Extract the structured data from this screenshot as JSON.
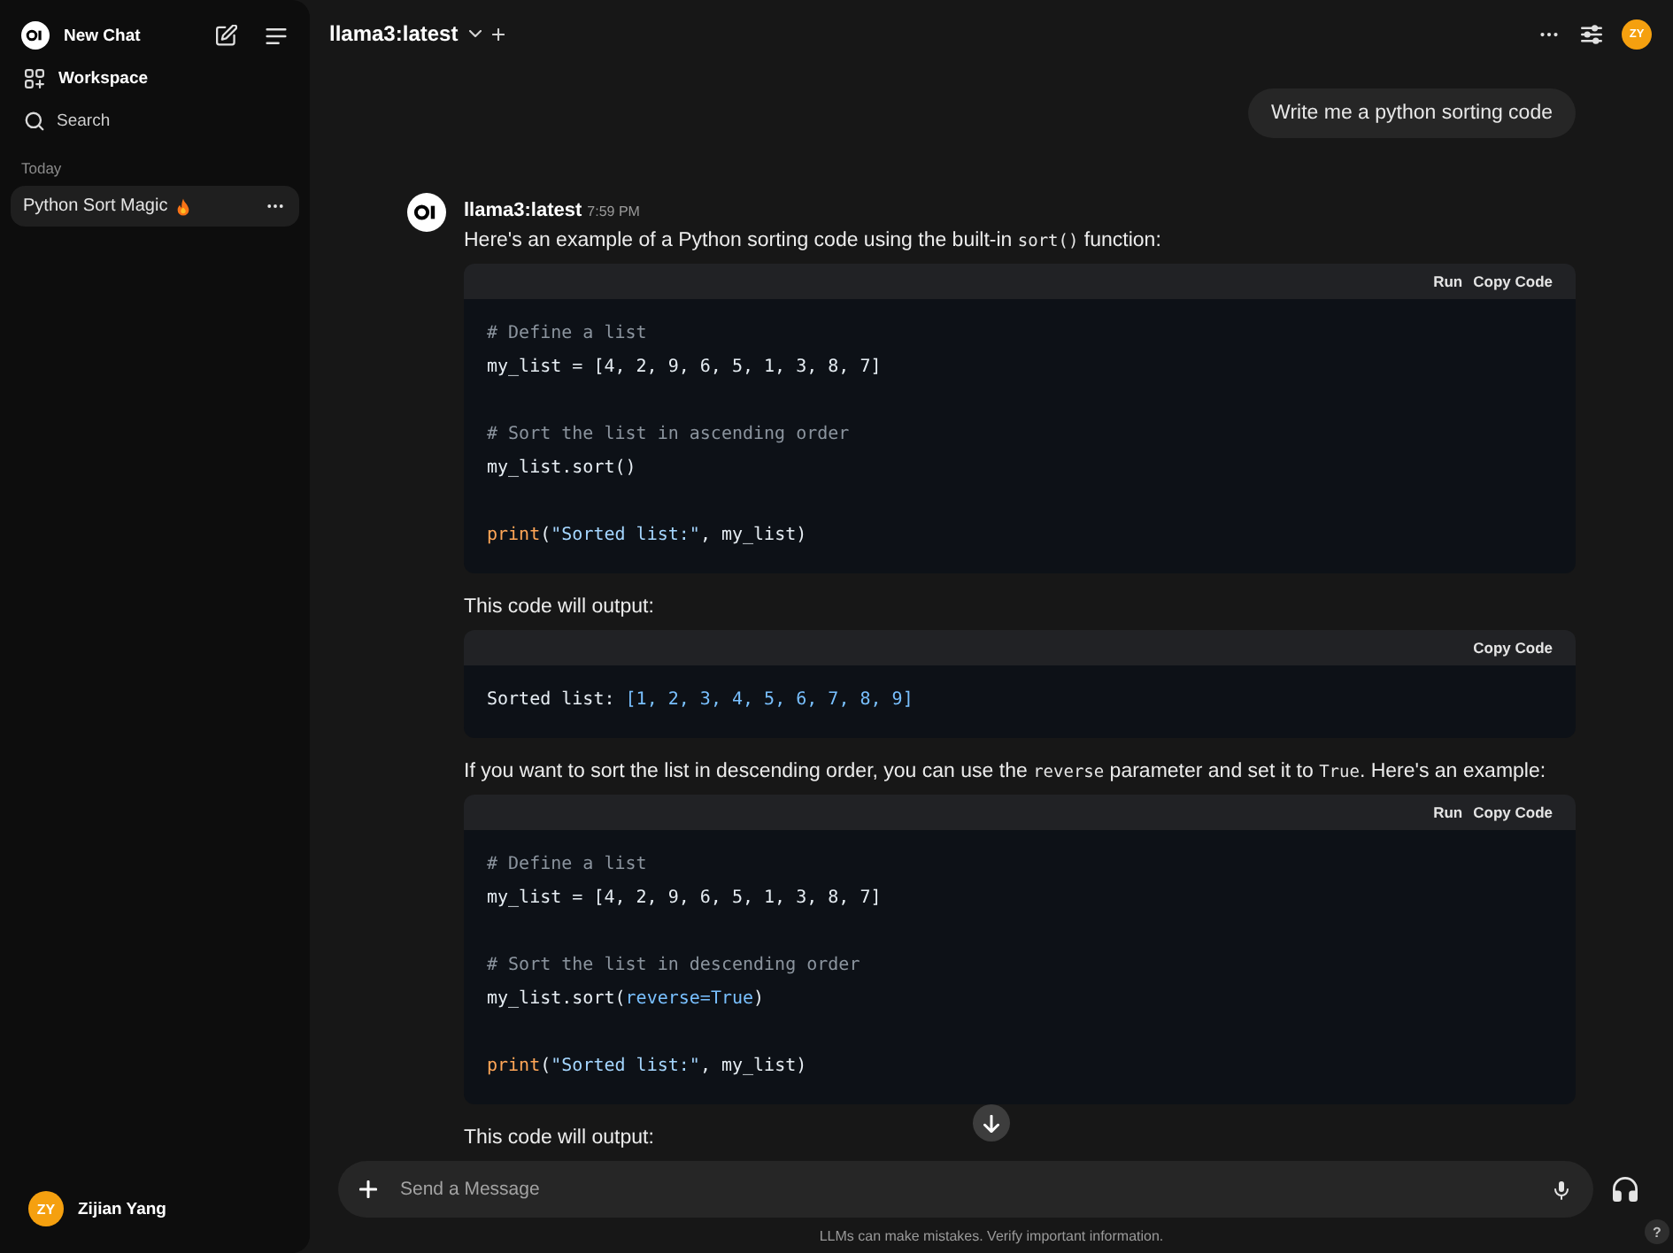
{
  "sidebar": {
    "app_name": "New Chat",
    "nav": [
      {
        "kind": "workspace",
        "label": "Workspace"
      },
      {
        "kind": "search",
        "label": "Search"
      }
    ],
    "section_label": "Today",
    "chats": [
      {
        "title": "Python Sort Magic",
        "selected": true
      }
    ],
    "user": {
      "initials": "ZY",
      "name": "Zijian Yang"
    }
  },
  "header": {
    "model": "llama3:latest",
    "avatar_initials": "ZY"
  },
  "messages": [
    {
      "kind": "user",
      "text": "Write me a python sorting code"
    },
    {
      "kind": "assistant",
      "model": "llama3:latest",
      "time": "7:59 PM",
      "blocks": [
        {
          "kind": "paragraph",
          "parts": [
            {
              "kind": "text",
              "text": "Here's an example of a Python sorting code using the built-in "
            },
            {
              "kind": "code",
              "text": "sort()"
            },
            {
              "kind": "text",
              "text": " function:"
            }
          ]
        },
        {
          "kind": "code",
          "actions": [
            "Run",
            "Copy Code"
          ],
          "groups": [
            {
              "lines": [
                {
                  "tokens": [
                    {
                      "kind": "comment",
                      "text": "# Define a list"
                    }
                  ]
                },
                {
                  "tokens": [
                    {
                      "kind": "plain",
                      "text": "my_list = [4, 2, 9, 6, 5, 1, 3, 8, 7]"
                    }
                  ]
                }
              ]
            },
            {
              "lines": [
                {
                  "tokens": [
                    {
                      "kind": "comment",
                      "text": "# Sort the list in ascending order"
                    }
                  ]
                },
                {
                  "tokens": [
                    {
                      "kind": "plain",
                      "text": "my_list.sort()"
                    }
                  ]
                }
              ]
            },
            {
              "lines": [
                {
                  "tokens": [
                    {
                      "kind": "builtin",
                      "text": "print"
                    },
                    {
                      "kind": "plain",
                      "text": "("
                    },
                    {
                      "kind": "string",
                      "text": "\"Sorted list:\""
                    },
                    {
                      "kind": "plain",
                      "text": ", my_list)"
                    }
                  ]
                }
              ]
            }
          ]
        },
        {
          "kind": "paragraph",
          "parts": [
            {
              "kind": "text",
              "text": "This code will output:"
            }
          ]
        },
        {
          "kind": "code",
          "actions": [
            "Copy Code"
          ],
          "groups": [
            {
              "lines": [
                {
                  "tokens": [
                    {
                      "kind": "plain",
                      "text": "Sorted list: "
                    },
                    {
                      "kind": "literal",
                      "text": "[1, 2, 3, 4, 5, 6, 7, 8, 9]"
                    }
                  ]
                }
              ]
            }
          ]
        },
        {
          "kind": "paragraph",
          "parts": [
            {
              "kind": "text",
              "text": "If you want to sort the list in descending order, you can use the "
            },
            {
              "kind": "code",
              "text": "reverse"
            },
            {
              "kind": "text",
              "text": " parameter and set it to "
            },
            {
              "kind": "code",
              "text": "True"
            },
            {
              "kind": "text",
              "text": ". Here's an example:"
            }
          ]
        },
        {
          "kind": "code",
          "actions": [
            "Run",
            "Copy Code"
          ],
          "groups": [
            {
              "lines": [
                {
                  "tokens": [
                    {
                      "kind": "comment",
                      "text": "# Define a list"
                    }
                  ]
                },
                {
                  "tokens": [
                    {
                      "kind": "plain",
                      "text": "my_list = [4, 2, 9, 6, 5, 1, 3, 8, 7]"
                    }
                  ]
                }
              ]
            },
            {
              "lines": [
                {
                  "tokens": [
                    {
                      "kind": "comment",
                      "text": "# Sort the list in descending order"
                    }
                  ]
                },
                {
                  "tokens": [
                    {
                      "kind": "plain",
                      "text": "my_list.sort("
                    },
                    {
                      "kind": "literal",
                      "text": "reverse=True"
                    },
                    {
                      "kind": "plain",
                      "text": ")"
                    }
                  ]
                }
              ]
            },
            {
              "lines": [
                {
                  "tokens": [
                    {
                      "kind": "builtin",
                      "text": "print"
                    },
                    {
                      "kind": "plain",
                      "text": "("
                    },
                    {
                      "kind": "string",
                      "text": "\"Sorted list:\""
                    },
                    {
                      "kind": "plain",
                      "text": ", my_list)"
                    }
                  ]
                }
              ]
            }
          ]
        },
        {
          "kind": "paragraph",
          "parts": [
            {
              "kind": "text",
              "text": "This code will output:"
            }
          ]
        }
      ]
    }
  ],
  "composer": {
    "placeholder": "Send a Message"
  },
  "disclaimer": "LLMs can make mistakes. Verify important information.",
  "help": "?"
}
